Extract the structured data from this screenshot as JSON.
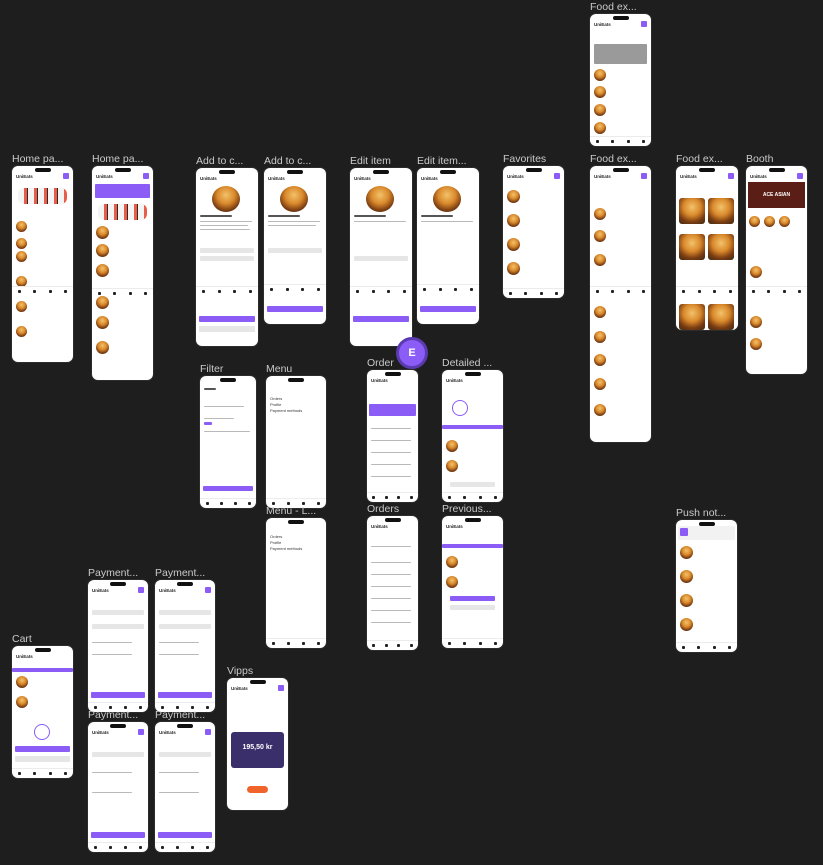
{
  "canvas": {
    "background": "#1e1e1e",
    "accent": "#8b5cf6"
  },
  "frames": [
    {
      "label": "Food ex...",
      "app": "UniEats",
      "kind": "food-list"
    },
    {
      "label": "Home pa...",
      "app": "UniEats",
      "kind": "home"
    },
    {
      "label": "Home pa...",
      "app": "UniEats",
      "kind": "home"
    },
    {
      "label": "Add to c...",
      "app": "UniEats",
      "kind": "item"
    },
    {
      "label": "Add to c...",
      "app": "UniEats",
      "kind": "item"
    },
    {
      "label": "Edit item",
      "app": "UniEats",
      "kind": "item"
    },
    {
      "label": "Edit item...",
      "app": "UniEats",
      "kind": "item"
    },
    {
      "label": "Favorites",
      "app": "UniEats",
      "kind": "food-list"
    },
    {
      "label": "Food ex...",
      "app": "UniEats",
      "kind": "food-list"
    },
    {
      "label": "Food ex...",
      "app": "UniEats",
      "kind": "grid"
    },
    {
      "label": "Booth",
      "app": "UniEats",
      "kind": "booth"
    },
    {
      "label": "Filter",
      "app": "",
      "kind": "filter"
    },
    {
      "label": "Menu",
      "app": "",
      "kind": "menu"
    },
    {
      "label": "Order",
      "app": "UniEats",
      "kind": "orders"
    },
    {
      "label": "Detailed ...",
      "app": "UniEats",
      "kind": "detail"
    },
    {
      "label": "Menu - L...",
      "app": "",
      "kind": "menu"
    },
    {
      "label": "Orders",
      "app": "UniEats",
      "kind": "orders"
    },
    {
      "label": "Previous...",
      "app": "UniEats",
      "kind": "detail"
    },
    {
      "label": "Push not...",
      "app": "",
      "kind": "food-list"
    },
    {
      "label": "Payment...",
      "app": "UniEats",
      "kind": "payment"
    },
    {
      "label": "Payment...",
      "app": "UniEats",
      "kind": "payment"
    },
    {
      "label": "Cart",
      "app": "UniEats",
      "kind": "cart"
    },
    {
      "label": "Payment...",
      "app": "UniEats",
      "kind": "payment"
    },
    {
      "label": "Payment...",
      "app": "UniEats",
      "kind": "payment"
    },
    {
      "label": "Vipps",
      "app": "UniEats",
      "kind": "vipps"
    }
  ],
  "item_screen": {
    "title": "Cheesy Bacon Burger"
  },
  "menu_screen": {
    "items": [
      "Orders",
      "Profile",
      "Payment methods"
    ]
  },
  "vipps_screen": {
    "amount": "195,50 kr"
  },
  "booth_screen": {
    "banner": "ACE ASIAN"
  },
  "collaborator": {
    "initial": "E"
  }
}
